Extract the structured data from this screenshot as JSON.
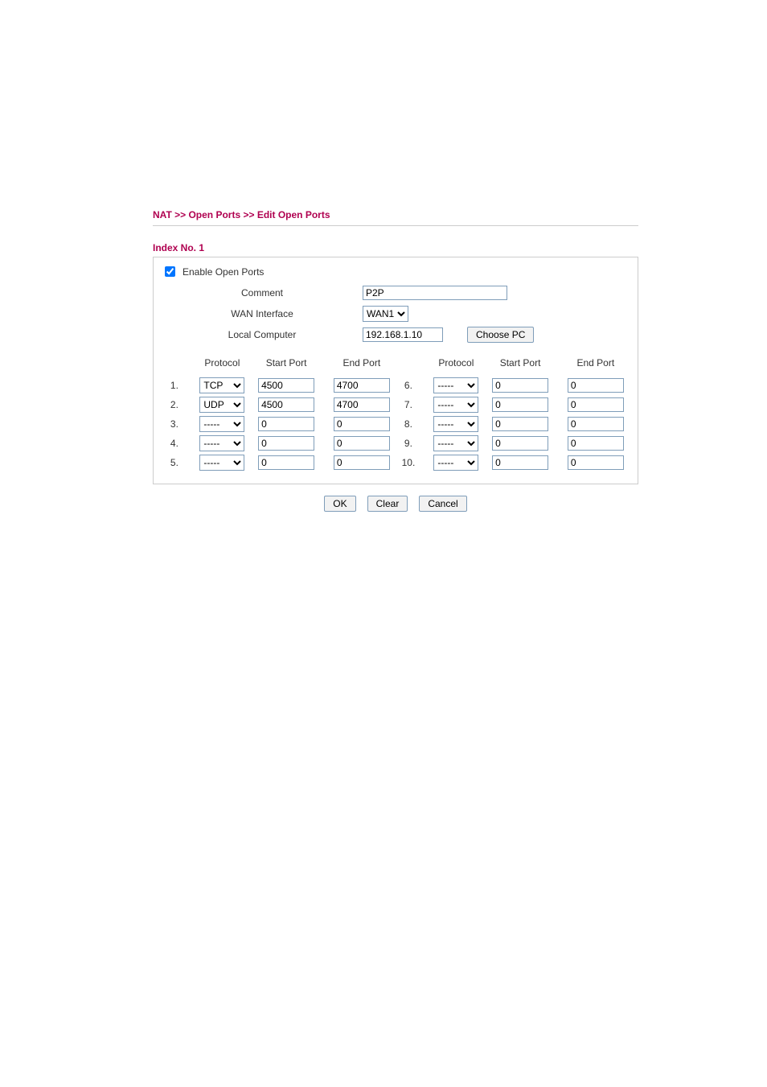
{
  "breadcrumb": "NAT >> Open Ports >> Edit Open Ports",
  "section_title": "Index No. 1",
  "enable": {
    "checked": true,
    "label": "Enable Open Ports"
  },
  "form": {
    "comment": {
      "label": "Comment",
      "value": "P2P"
    },
    "wan": {
      "label": "WAN Interface",
      "value": "WAN1",
      "options": [
        "WAN1"
      ]
    },
    "local": {
      "label": "Local Computer",
      "value": "192.168.1.10",
      "choose_btn": "Choose PC"
    }
  },
  "headers": {
    "protocol": "Protocol",
    "start_port": "Start Port",
    "end_port": "End Port"
  },
  "proto_options": [
    "-----",
    "TCP",
    "UDP"
  ],
  "rows_left": [
    {
      "idx": "1.",
      "proto": "TCP",
      "start": "4500",
      "end": "4700"
    },
    {
      "idx": "2.",
      "proto": "UDP",
      "start": "4500",
      "end": "4700"
    },
    {
      "idx": "3.",
      "proto": "-----",
      "start": "0",
      "end": "0"
    },
    {
      "idx": "4.",
      "proto": "-----",
      "start": "0",
      "end": "0"
    },
    {
      "idx": "5.",
      "proto": "-----",
      "start": "0",
      "end": "0"
    }
  ],
  "rows_right": [
    {
      "idx": "6.",
      "proto": "-----",
      "start": "0",
      "end": "0"
    },
    {
      "idx": "7.",
      "proto": "-----",
      "start": "0",
      "end": "0"
    },
    {
      "idx": "8.",
      "proto": "-----",
      "start": "0",
      "end": "0"
    },
    {
      "idx": "9.",
      "proto": "-----",
      "start": "0",
      "end": "0"
    },
    {
      "idx": "10.",
      "proto": "-----",
      "start": "0",
      "end": "0"
    }
  ],
  "buttons": {
    "ok": "OK",
    "clear": "Clear",
    "cancel": "Cancel"
  }
}
